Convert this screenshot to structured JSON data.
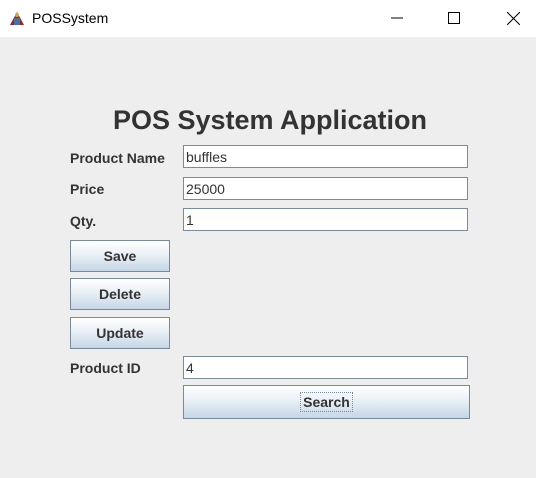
{
  "window": {
    "title": "POSSystem",
    "icon": "java-app-icon"
  },
  "form": {
    "heading": "POS System Application",
    "product_name": {
      "label": "Product Name",
      "value": "buffles"
    },
    "price": {
      "label": "Price",
      "value": "25000"
    },
    "qty": {
      "label": "Qty.",
      "value": "1"
    },
    "product_id": {
      "label": "Product ID",
      "value": "4"
    }
  },
  "buttons": {
    "save": "Save",
    "delete": "Delete",
    "update": "Update",
    "search": "Search"
  },
  "colors": {
    "background": "#eeeeee",
    "text": "#333333",
    "button_gradient_bottom": "#c5d6e6"
  }
}
